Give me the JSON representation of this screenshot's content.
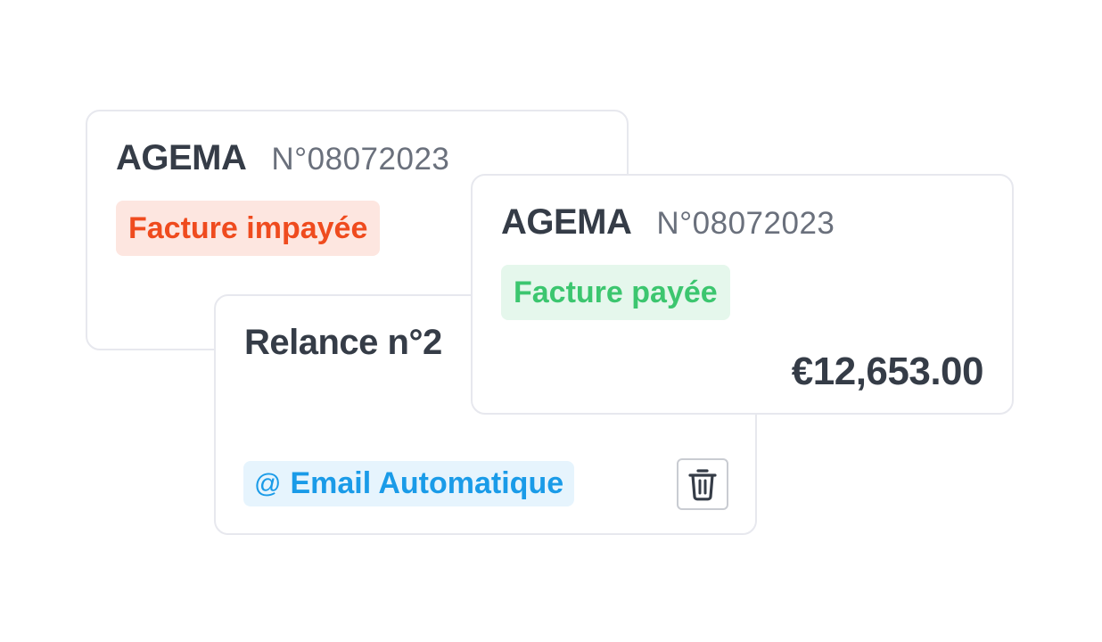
{
  "cards": {
    "back": {
      "company": "AGEMA",
      "invoice_number": "N°08072023",
      "status": "Facture impayée"
    },
    "relance": {
      "title": "Relance n°2",
      "channel_icon": "@",
      "channel": "Email Automatique",
      "delete_icon": "trash-icon"
    },
    "paid": {
      "company": "AGEMA",
      "invoice_number": "N°08072023",
      "status": "Facture payée",
      "amount": "€12,653.00"
    }
  },
  "colors": {
    "text_dark": "#353c47",
    "text_muted": "#6a707c",
    "unpaid_text": "#ef4b1e",
    "unpaid_bg": "#fde6e0",
    "paid_text": "#3cc66f",
    "paid_bg": "#e5f7ec",
    "email_text": "#1a9be8",
    "email_bg": "#e6f4fd",
    "card_border": "#e7e8ee"
  }
}
